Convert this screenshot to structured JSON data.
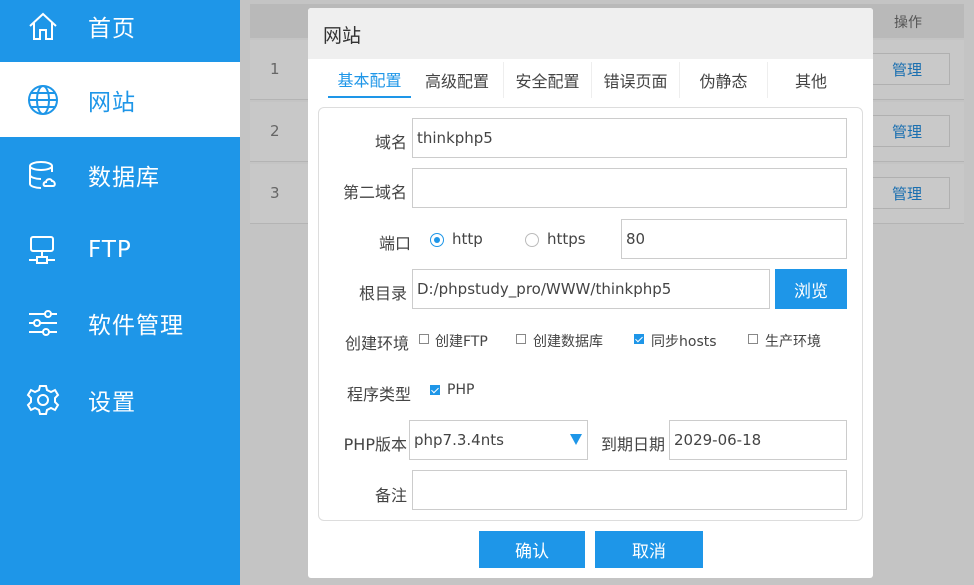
{
  "sidebar": {
    "items": [
      {
        "label": "首页",
        "icon": "home-icon"
      },
      {
        "label": "网站",
        "icon": "globe-icon",
        "active": true
      },
      {
        "label": "数据库",
        "icon": "database-icon"
      },
      {
        "label": "FTP",
        "icon": "ftp-server-icon"
      },
      {
        "label": "软件管理",
        "icon": "sliders-icon"
      },
      {
        "label": "设置",
        "icon": "gear-icon"
      }
    ]
  },
  "table": {
    "op_header": "操作",
    "rows": [
      {
        "num": "1",
        "action": "管理"
      },
      {
        "num": "2",
        "action": "管理"
      },
      {
        "num": "3",
        "action": "管理"
      }
    ]
  },
  "modal": {
    "title": "网站",
    "tabs": [
      {
        "label": "基本配置",
        "active": true
      },
      {
        "label": "高级配置"
      },
      {
        "label": "安全配置"
      },
      {
        "label": "错误页面"
      },
      {
        "label": "伪静态"
      },
      {
        "label": "其他"
      }
    ],
    "form": {
      "domain_label": "域名",
      "domain_value": "thinkphp5",
      "second_domain_label": "第二域名",
      "second_domain_value": "",
      "port_label": "端口",
      "protocol_http": "http",
      "protocol_https": "https",
      "protocol_selected": "http",
      "port_value": "80",
      "root_label": "根目录",
      "root_value": "D:/phpstudy_pro/WWW/thinkphp5",
      "browse_label": "浏览",
      "env_label": "创建环境",
      "env_options": [
        {
          "label": "创建FTP",
          "checked": false
        },
        {
          "label": "创建数据库",
          "checked": false
        },
        {
          "label": "同步hosts",
          "checked": true
        },
        {
          "label": "生产环境",
          "checked": false
        }
      ],
      "program_label": "程序类型",
      "program_option": {
        "label": "PHP",
        "checked": true
      },
      "php_version_label": "PHP版本",
      "php_version_value": "php7.3.4nts",
      "expire_label": "到期日期",
      "expire_value": "2029-06-18",
      "note_label": "备注",
      "note_value": ""
    },
    "confirm_label": "确认",
    "cancel_label": "取消"
  },
  "colors": {
    "accent": "#1e96e8",
    "overlay": "#c4c4c4"
  }
}
